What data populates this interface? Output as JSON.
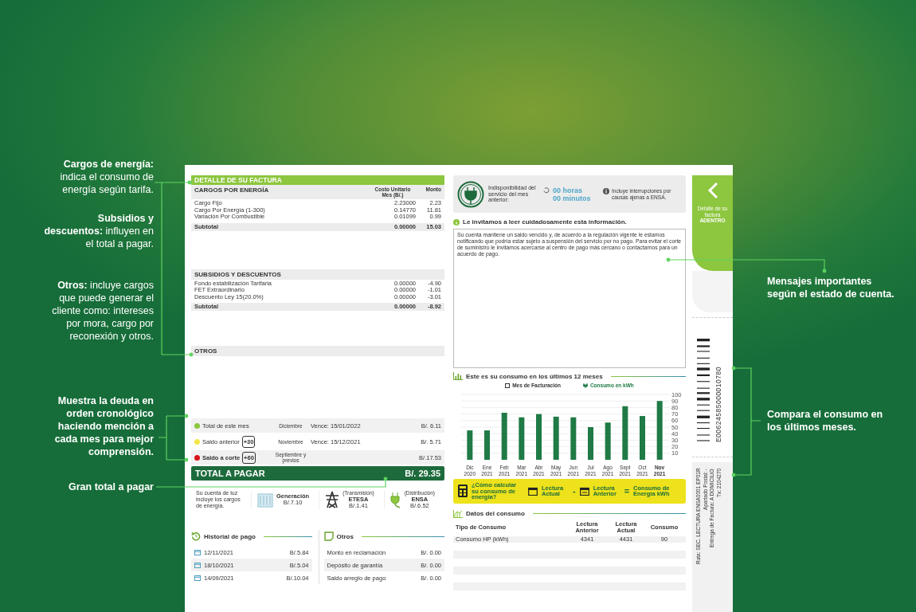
{
  "annotations_left": [
    {
      "text": "**Cargos de energía:** indica el consumo de energía según tarifa.",
      "bold": false
    },
    {
      "text": "**Subsidios y descuentos:** influyen en el total a pagar.",
      "bold": false
    },
    {
      "text": "**Otros:** incluye cargos que puede generar el cliente como: intereses por mora, cargo por reconexión y otros.",
      "bold": false
    },
    {
      "text": "Muestra la deuda en orden cronológico haciendo mención a cada mes para mejor comprensión.",
      "bold": true
    },
    {
      "text": "Gran total a pagar",
      "bold": true
    }
  ],
  "annotations_right": [
    {
      "text": "Mensajes importantes según el estado de cuenta.",
      "bold": true
    },
    {
      "text": "Compara el consumo en los últimos meses.",
      "bold": true
    }
  ],
  "bill": {
    "title": "DETALLE DE SU FACTURA",
    "sections": [
      {
        "heading": "CARGOS POR ENERGÍA",
        "unit_header": "Costo Unitario Mes (B/.)",
        "amount_header": "Monto",
        "rows": [
          {
            "label": "Cargo Fijo",
            "unit": "2.23000",
            "amount": "2.23"
          },
          {
            "label": "Cargo Por Energía (1-300)",
            "unit": "0.14770",
            "amount": "11.81"
          },
          {
            "label": "Variación Por Combustible",
            "unit": "0.01099",
            "amount": "0.99"
          }
        ],
        "subtotal": {
          "label": "Subtotal",
          "unit": "0.00000",
          "amount": "15.03"
        }
      },
      {
        "heading": "SUBSIDIOS Y DESCUENTOS",
        "rows": [
          {
            "label": "Fondo estabilización Tarifaria",
            "unit": "0.00000",
            "amount": "-4.90"
          },
          {
            "label": "FET Extraordinario",
            "unit": "0.00000",
            "amount": "-1.01"
          },
          {
            "label": "Descuento Ley 15(20.0%)",
            "unit": "0.00000",
            "amount": "-3.01"
          }
        ],
        "subtotal": {
          "label": "Subtotal",
          "unit": "0.00000",
          "amount": "-8.92"
        }
      },
      {
        "heading": "OTROS"
      }
    ],
    "balances": [
      {
        "label": "Total de este mes",
        "color": "#8dc63f",
        "month": "Diciembre",
        "due": "Vence: 15/01/2022",
        "amount": "B/. 6.11"
      },
      {
        "label": "Saldo anterior",
        "badge": "+30",
        "color": "#f2e64a",
        "month": "Noviembre",
        "due": "Vence: 15/12/2021",
        "amount": "B/. 5.71"
      },
      {
        "label": "Saldo a corte",
        "badge": "+60",
        "color": "#d7141a",
        "month": "Septiembre y previos",
        "amount": "B/.17.53"
      }
    ],
    "total": {
      "label": "TOTAL A PAGAR",
      "amount": "B/. 29.35"
    },
    "breakdown": {
      "intro": "Su cuenta de luz incluye los cargos de energía.",
      "items": [
        {
          "kind": "generation",
          "name": "Generación",
          "amount": "B/.7.10"
        },
        {
          "kind": "transmission",
          "caption": "(Transmisión)",
          "name": "ETESA",
          "amount": "B/.1.41"
        },
        {
          "kind": "distribution",
          "caption": "(Distribución)",
          "name": "ENSA",
          "amount": "B/.6.52"
        }
      ]
    },
    "history": {
      "title": "Historial de pago",
      "rows": [
        {
          "date": "12/11/2021",
          "amount": "B/.5.84"
        },
        {
          "date": "18/10/2021",
          "amount": "B/.5.04"
        },
        {
          "date": "14/09/2021",
          "amount": "B/.10.04"
        }
      ]
    },
    "others": {
      "title": "Otros",
      "rows": [
        {
          "label": "Monto en reclamación",
          "amount": "B/. 0.00"
        },
        {
          "label": "Depósito de garantía",
          "amount": "B/. 0.00"
        },
        {
          "label": "Saldo arreglo de pago",
          "amount": "B/. 0.00"
        }
      ]
    },
    "outage": {
      "label": "Indisponibilidad del servicio del mes anterior:",
      "hours": "00 horas",
      "minutes": "00 minutos",
      "note": "Incluye interrupciones por causas ajenas a ENSA."
    },
    "notice": {
      "heading": "Le invitamos a leer cuidadosamente esta información.",
      "message": "Su cuenta mantiene un saldo vencido y, de acuerdo a la regulación vigente le estamos notificando que podría estar sujeto a suspensión del servicio por no pago. Para evitar el corte de suministro le invitamos acercarse al centro de pago más cercano o contactarnos para un acuerdo de pago."
    },
    "consumption": {
      "title": "Este es su consumo en los últimos 12 meses",
      "legend_x": "Mes de Facturación",
      "chart_data": {
        "type": "bar",
        "categories": [
          "Dic 2020",
          "Ene 2021",
          "Feb 2021",
          "Mar 2021",
          "Abr 2021",
          "May 2021",
          "Jun 2021",
          "Jul 2021",
          "Ago 2021",
          "Sept 2021",
          "Oct 2021",
          "Nov 2021"
        ],
        "series": [
          {
            "name": "Consumo en kWh",
            "color": "#1f7a45",
            "values": [
              45,
              45,
              72,
              65,
              70,
              66,
              65,
              50,
              57,
              82,
              67,
              90
            ]
          }
        ],
        "ylim": [
          0,
          100
        ],
        "grid": true,
        "yticks": [
          10,
          20,
          30,
          40,
          50,
          60,
          70,
          80,
          90,
          100
        ]
      }
    },
    "formula": {
      "question": "¿Cómo calcular su consumo de energía?",
      "current": "Lectura Actual",
      "minus": "-",
      "previous": "Lectura Anterior",
      "equals": "=",
      "result": "Consumo de Energía kWh"
    },
    "usage": {
      "title": "Datos del consumo",
      "columns": [
        "Tipo de Consumo",
        "Lectura Anterior",
        "Lectura Actual",
        "Consumo"
      ],
      "rows": [
        [
          "Consumo HP (kWh)",
          "4341",
          "4431",
          "90"
        ]
      ]
    },
    "side": {
      "tab_label": "Detalle de su factura",
      "tab_emphasis": "ADENTRO",
      "barcode_number": "E00624585000010780",
      "address": [
        "Ruta: SEC. LECTURA ENSA0001 EP01R",
        "Apartado Postal: -",
        "Entrega de Factura: A DOMICILIO",
        "Tx: 2104270"
      ]
    }
  }
}
